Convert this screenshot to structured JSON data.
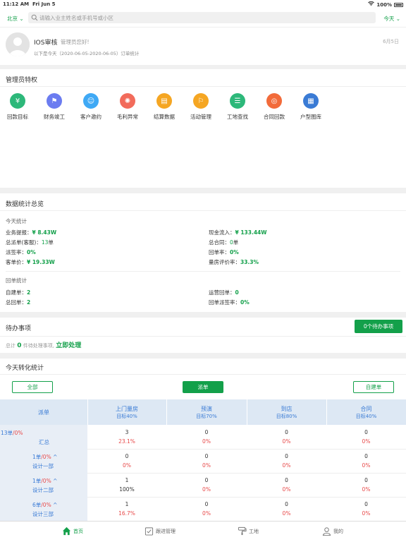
{
  "status_bar": {
    "time": "11:12 AM",
    "date": "Fri Jun 5",
    "battery": "100%"
  },
  "top_bar": {
    "city": "北京",
    "search_placeholder": "请输入业主姓名或手机号或小区",
    "range": "今天"
  },
  "user": {
    "name": "IOS审核",
    "greeting": "管理员您好!",
    "subtitle": "以下是今天（2020-06-05-2020-06-05）订单统计",
    "date": "6月5日"
  },
  "privileges": {
    "title": "管理员特权",
    "items": [
      {
        "label": "回款目标",
        "icon": "yen-icon",
        "color": "#2db87a"
      },
      {
        "label": "财务竣工",
        "icon": "flag-icon",
        "color": "#6b7cf0"
      },
      {
        "label": "客户邀约",
        "icon": "person-icon",
        "color": "#3fa9f5"
      },
      {
        "label": "毛利异常",
        "icon": "bulb-icon",
        "color": "#f26b5b"
      },
      {
        "label": "结算数据",
        "icon": "doc-icon",
        "color": "#f5a623"
      },
      {
        "label": "活动管理",
        "icon": "flag2-icon",
        "color": "#f5a623"
      },
      {
        "label": "工地查找",
        "icon": "list-icon",
        "color": "#2db87a"
      },
      {
        "label": "合同回款",
        "icon": "coin-icon",
        "color": "#f26b3a"
      },
      {
        "label": "户型图库",
        "icon": "plan-icon",
        "color": "#3a7bd5"
      }
    ]
  },
  "overview": {
    "title": "数据统计总览",
    "today_label": "今天统计",
    "left": [
      {
        "k": "业务提报：",
        "v": "¥ 8.43W",
        "green": true
      },
      {
        "k": "总派单(客服)：",
        "v": "13",
        "suffix": "单",
        "green": false
      },
      {
        "k": "派签率：",
        "v": "0%",
        "green": true
      },
      {
        "k": "客单价：",
        "v": "¥ 19.33W",
        "green": true
      }
    ],
    "right": [
      {
        "k": "现金流入：",
        "v": "¥ 133.44W",
        "green": true
      },
      {
        "k": "总合同：",
        "v": "0",
        "suffix": "单",
        "green": false
      },
      {
        "k": "回单率：",
        "v": "0%",
        "green": true
      },
      {
        "k": "量房评价率：",
        "v": "33.3%",
        "green": true
      }
    ],
    "return_label": "回单统计",
    "left2": [
      {
        "k": "自建单：",
        "v": "2"
      },
      {
        "k": "总回单：",
        "v": "2"
      }
    ],
    "right2": [
      {
        "k": "运营回单：",
        "v": "0"
      },
      {
        "k": "回单派签率：",
        "v": "0%"
      }
    ]
  },
  "todo": {
    "title": "待办事项",
    "button": "0个待办事项",
    "prefix": "总计",
    "count": "0",
    "middle": "件待处理事项,",
    "action": "立即处理"
  },
  "conversion": {
    "title": "今天转化统计",
    "tabs": [
      "全部",
      "派单",
      "自建单"
    ],
    "header": {
      "first": "派单",
      "cols": [
        {
          "name": "上门量房",
          "target": "目标40%"
        },
        {
          "name": "预演",
          "target": "目标70%"
        },
        {
          "name": "到店",
          "target": "目标80%"
        },
        {
          "name": "合同",
          "target": "目标40%"
        }
      ]
    },
    "rows": [
      {
        "stat": "13单",
        "rate": "/0%",
        "name": "汇总",
        "cells": [
          [
            "3",
            "23.1%"
          ],
          [
            "0",
            "0%"
          ],
          [
            "0",
            "0%"
          ],
          [
            "0",
            "0%"
          ]
        ],
        "rate_black": [
          false,
          false,
          false,
          false
        ]
      },
      {
        "stat": "1单",
        "rate": "/0%",
        "name": "设计一部",
        "cells": [
          [
            "0",
            "0%"
          ],
          [
            "0",
            "0%"
          ],
          [
            "0",
            "0%"
          ],
          [
            "0",
            "0%"
          ]
        ],
        "rate_black": [
          false,
          false,
          false,
          false
        ]
      },
      {
        "stat": "1单",
        "rate": "/0%",
        "name": "设计二部",
        "cells": [
          [
            "1",
            "100%"
          ],
          [
            "0",
            "0%"
          ],
          [
            "0",
            "0%"
          ],
          [
            "0",
            "0%"
          ]
        ],
        "rate_black": [
          true,
          false,
          false,
          false
        ]
      },
      {
        "stat": "6单",
        "rate": "/0%",
        "name": "设计三部",
        "cells": [
          [
            "1",
            "16.7%"
          ],
          [
            "0",
            "0%"
          ],
          [
            "0",
            "0%"
          ],
          [
            "0",
            "0%"
          ]
        ],
        "rate_black": [
          false,
          false,
          false,
          false
        ]
      }
    ]
  },
  "tabbar": [
    {
      "label": "首页",
      "icon": "home-icon",
      "active": true
    },
    {
      "label": "跟进管理",
      "icon": "checklist-icon",
      "active": false
    },
    {
      "label": "工地",
      "icon": "roller-icon",
      "active": false
    },
    {
      "label": "我的",
      "icon": "profile-icon",
      "active": false
    }
  ]
}
